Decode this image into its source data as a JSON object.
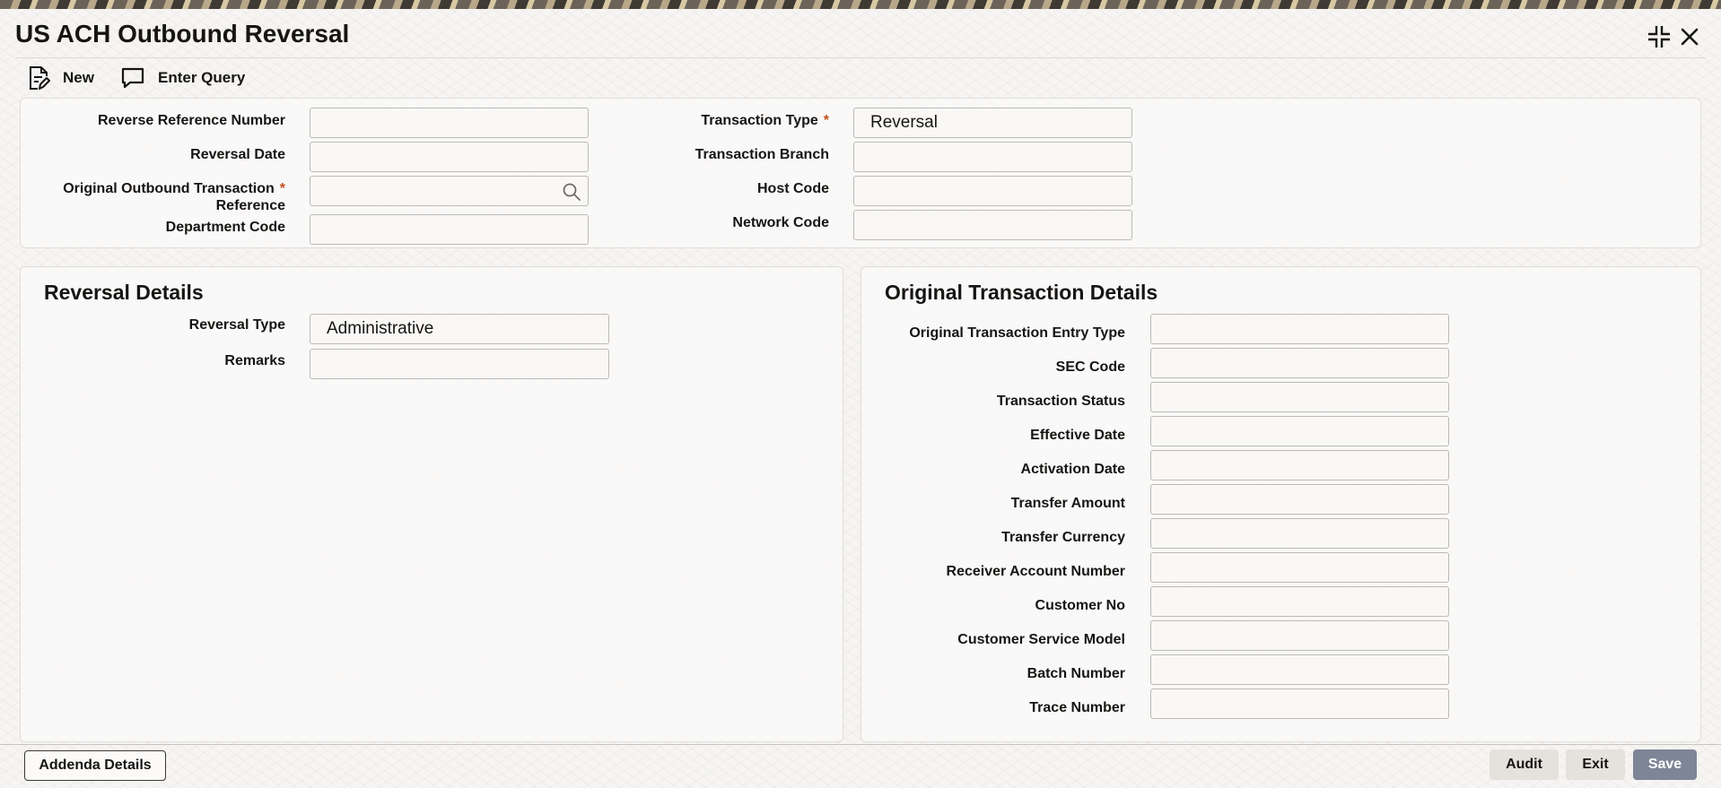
{
  "window": {
    "title": "US ACH Outbound Reversal"
  },
  "toolbar": {
    "new_label": "New",
    "enter_query_label": "Enter Query"
  },
  "header_form": {
    "reverse_reference_number": {
      "label": "Reverse Reference Number",
      "value": ""
    },
    "reversal_date": {
      "label": "Reversal Date",
      "value": ""
    },
    "original_outbound_txn_ref": {
      "label_line1": "Original Outbound Transaction",
      "label_line2": "Reference",
      "required": "*",
      "value": ""
    },
    "department_code": {
      "label": "Department Code",
      "value": ""
    },
    "transaction_type": {
      "label": "Transaction Type",
      "required": "*",
      "value": "Reversal"
    },
    "transaction_branch": {
      "label": "Transaction Branch",
      "value": ""
    },
    "host_code": {
      "label": "Host Code",
      "value": ""
    },
    "network_code": {
      "label": "Network Code",
      "value": ""
    }
  },
  "reversal_details": {
    "title": "Reversal Details",
    "reversal_type": {
      "label": "Reversal Type",
      "value": "Administrative"
    },
    "remarks": {
      "label": "Remarks",
      "value": ""
    }
  },
  "original_txn_details": {
    "title": "Original Transaction Details",
    "fields": [
      {
        "label": "Original Transaction Entry Type",
        "value": ""
      },
      {
        "label": "SEC Code",
        "value": ""
      },
      {
        "label": "Transaction Status",
        "value": ""
      },
      {
        "label": "Effective Date",
        "value": ""
      },
      {
        "label": "Activation Date",
        "value": ""
      },
      {
        "label": "Transfer Amount",
        "value": ""
      },
      {
        "label": "Transfer Currency",
        "value": ""
      },
      {
        "label": "Receiver Account Number",
        "value": ""
      },
      {
        "label": "Customer No",
        "value": ""
      },
      {
        "label": "Customer Service Model",
        "value": ""
      },
      {
        "label": "Batch Number",
        "value": ""
      },
      {
        "label": "Trace Number",
        "value": ""
      }
    ]
  },
  "footer": {
    "addenda_details_label": "Addenda Details",
    "audit_label": "Audit",
    "exit_label": "Exit",
    "save_label": "Save"
  },
  "icons": {
    "new": "document-edit-icon",
    "enter_query": "speech-bubble-icon",
    "lookup": "search-icon",
    "minimize": "collapse-icon",
    "close": "close-icon"
  },
  "colors": {
    "required_asterisk": "#c1511c",
    "save_button": "#7e8597",
    "text": "#161513"
  }
}
